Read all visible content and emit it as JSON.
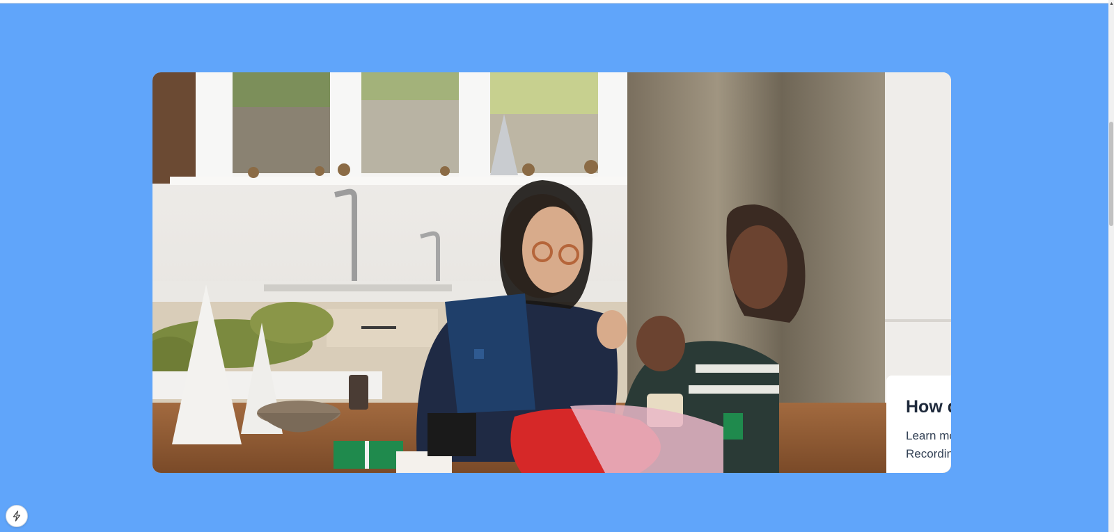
{
  "card": {
    "title": "How does work?",
    "body": "Learn more about screen Recording."
  },
  "icons": {
    "fab": "lightning-icon",
    "scroll_up": "chevron-up-icon"
  },
  "colors": {
    "page_background": "#60a5fa",
    "card_background": "#ffffff",
    "title_color": "#1e293b",
    "body_color": "#334155"
  }
}
